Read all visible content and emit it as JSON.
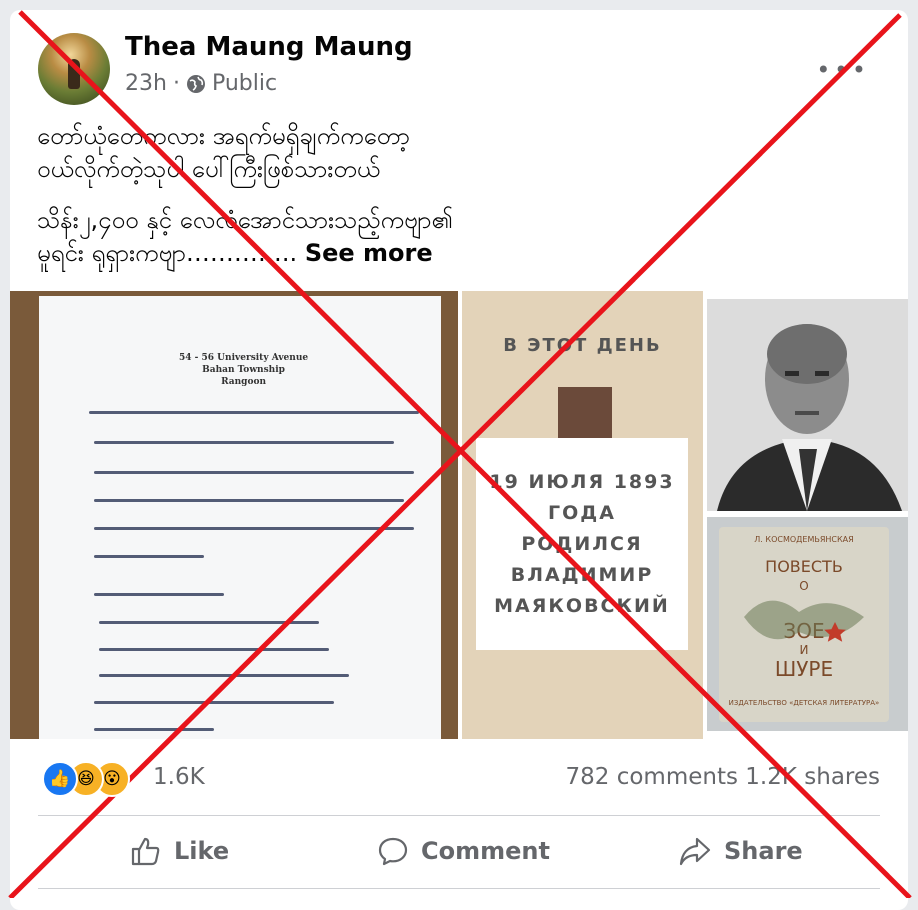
{
  "post": {
    "author": "Thea Maung Maung",
    "time": "23h",
    "separator": "·",
    "visibility": "Public",
    "text_line1": "တော်ယုံတေကလား အရက်မရှိချက်ကတော့",
    "text_line2": "ဝယ်လိုက်တဲ့သုပါ ပေါ်ကြီးဖြစ်သားတယ်",
    "text_line3": "သိန်း၂,၄၀၀ နှင့် လေလံအောင်သားသည့်ကဗျာ၏",
    "text_line4": "မူရင်း ရုရှားကဗျာ…………..",
    "see_more": "See more"
  },
  "letter": {
    "addr1": "54 - 56 University Avenue",
    "addr2": "Bahan Township",
    "addr3": "Rangoon"
  },
  "poster": {
    "top": "В ЭТОТ ДЕНЬ",
    "line1": "19 ИЮЛЯ 1893",
    "line2": "ГОДА",
    "line3": "РОДИЛСЯ",
    "line4": "ВЛАДИМИР",
    "line5": "МАЯКОВСКИЙ"
  },
  "book": {
    "author": "Л. КОСМОДЕМЬЯНСКАЯ",
    "title1": "ПОВЕСТЬ",
    "title2": "О",
    "title3": "ЗОЕ",
    "title4": "И",
    "title5": "ШУРЕ",
    "publisher": "ИЗДАТЕЛЬСТВО «ДЕТСКАЯ ЛИТЕРАТУРА»"
  },
  "engagement": {
    "reaction_count": "1.6K",
    "comments": "782 comments",
    "shares": "1.2K shares"
  },
  "actions": {
    "like": "Like",
    "comment": "Comment",
    "share": "Share"
  },
  "colors": {
    "accent": "#1877f2",
    "x_overlay": "#e8141b"
  }
}
